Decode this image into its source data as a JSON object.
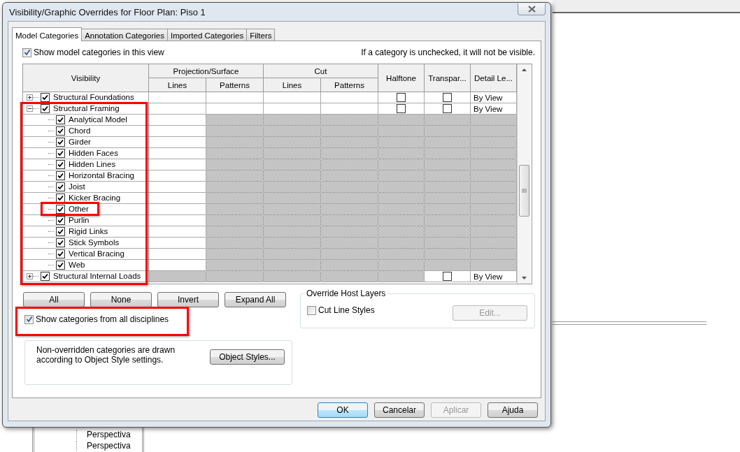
{
  "window": {
    "title": "Visibility/Graphic Overrides for Floor Plan: Piso 1"
  },
  "tabs": [
    {
      "label": "Model Categories",
      "selected": true
    },
    {
      "label": "Annotation Categories",
      "selected": false
    },
    {
      "label": "Imported Categories",
      "selected": false
    },
    {
      "label": "Filters",
      "selected": false
    }
  ],
  "show_model_categories": {
    "label": "Show model categories in this view",
    "checked": true
  },
  "hint": "If a category is unchecked, it will not be visible.",
  "table": {
    "first_column": "Visibility",
    "column_groups": [
      {
        "label": "Projection/Surface",
        "columns": [
          "Lines",
          "Patterns"
        ]
      },
      {
        "label": "Cut",
        "columns": [
          "Lines",
          "Patterns"
        ]
      }
    ],
    "columns_after": [
      "Halftone",
      "Transpar...",
      "Detail Le..."
    ],
    "rows": [
      {
        "name": "Structural Foundations",
        "checked": true,
        "expanded": false,
        "kind": "category",
        "halftone": false,
        "transparency": false,
        "detail": "By View"
      },
      {
        "name": "Structural Framing",
        "checked": true,
        "expanded": true,
        "kind": "category",
        "halftone": false,
        "transparency": false,
        "detail": "By View",
        "children": [
          {
            "name": "Analytical Model",
            "checked": true,
            "kind": "subcategory"
          },
          {
            "name": "Chord",
            "checked": true,
            "kind": "subcategory"
          },
          {
            "name": "Girder",
            "checked": true,
            "kind": "subcategory"
          },
          {
            "name": "Hidden Faces",
            "checked": true,
            "kind": "subcategory"
          },
          {
            "name": "Hidden Lines",
            "checked": true,
            "kind": "subcategory"
          },
          {
            "name": "Horizontal Bracing",
            "checked": true,
            "kind": "subcategory"
          },
          {
            "name": "Joist",
            "checked": true,
            "kind": "subcategory"
          },
          {
            "name": "Kicker Bracing",
            "checked": true,
            "kind": "subcategory"
          },
          {
            "name": "Other",
            "checked": true,
            "kind": "subcategory"
          },
          {
            "name": "Purlin",
            "checked": true,
            "kind": "subcategory"
          },
          {
            "name": "Rigid Links",
            "checked": true,
            "kind": "subcategory"
          },
          {
            "name": "Stick Symbols",
            "checked": true,
            "kind": "subcategory"
          },
          {
            "name": "Vertical Bracing",
            "checked": true,
            "kind": "subcategory"
          },
          {
            "name": "Web",
            "checked": true,
            "kind": "subcategory"
          }
        ]
      },
      {
        "name": "Structural Internal Loads",
        "checked": true,
        "expanded": false,
        "kind": "analytical",
        "transparency": false,
        "detail": "By View"
      }
    ]
  },
  "buttons": [
    "All",
    "None",
    "Invert",
    "Expand All"
  ],
  "show_all_disciplines": {
    "label": "Show categories from all disciplines",
    "checked": true
  },
  "override_host_layers": {
    "title": "Override Host Layers",
    "cut_line_styles": {
      "label": "Cut Line Styles",
      "checked": false
    },
    "edit_button": {
      "label": "Edit...",
      "disabled": true
    }
  },
  "object_styles": {
    "note": "Non-overridden categories are drawn according to Object Style settings.",
    "button": "Object Styles..."
  },
  "footer_buttons": [
    {
      "label": "OK",
      "default": true,
      "disabled": false
    },
    {
      "label": "Cancelar",
      "default": false,
      "disabled": false
    },
    {
      "label": "Aplicar",
      "default": false,
      "disabled": true
    },
    {
      "label": "Ajuda",
      "default": false,
      "disabled": false
    }
  ],
  "background": {
    "tree_items": [
      "Perspectiva",
      "Perspectiva"
    ]
  }
}
